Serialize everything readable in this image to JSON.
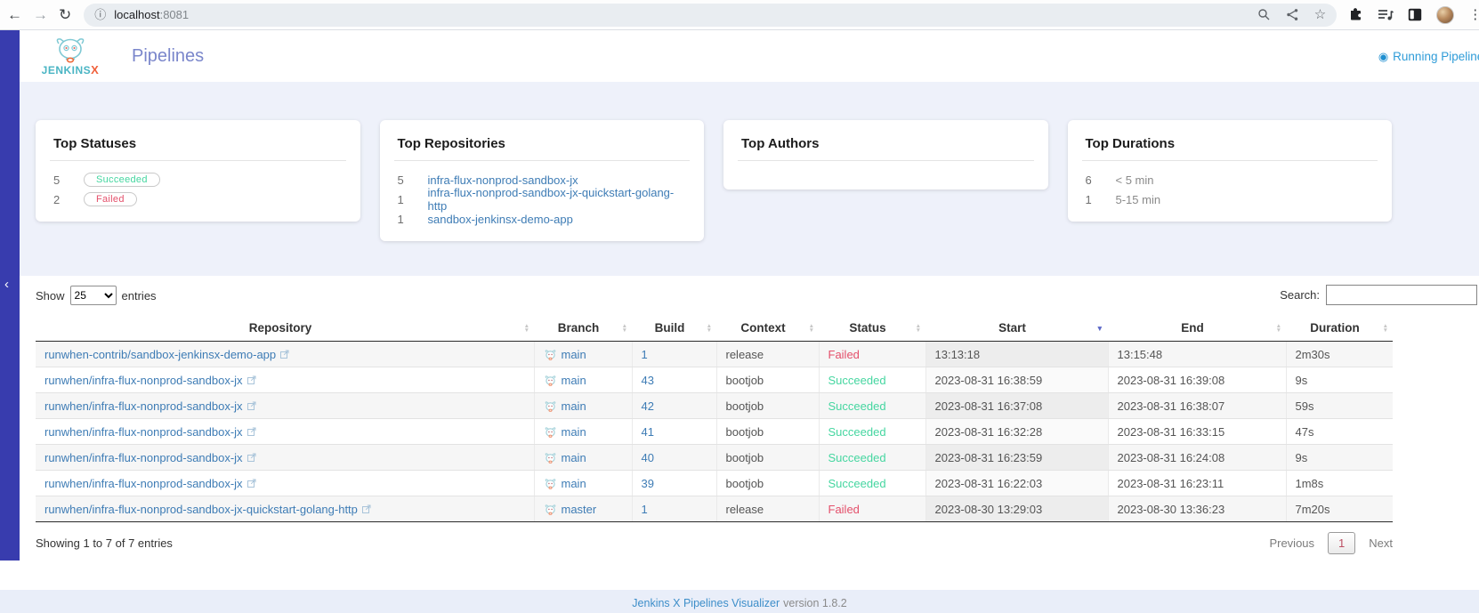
{
  "browser": {
    "url_host": "localhost",
    "url_port": ":8081"
  },
  "icons": {
    "back": "←",
    "forward": "→",
    "reload": "↻",
    "info": "ⓘ",
    "star": "☆",
    "menu": "⋮",
    "collapse": "‹",
    "radio": "◉"
  },
  "header": {
    "brand_jenkins": "JENKINS",
    "brand_x": "X",
    "title": "Pipelines",
    "running_label": "Running Pipelines"
  },
  "stats": {
    "statuses": {
      "title": "Top Statuses",
      "items": [
        {
          "count": "5",
          "label": "Succeeded",
          "type": "succeeded"
        },
        {
          "count": "2",
          "label": "Failed",
          "type": "failed"
        }
      ]
    },
    "repositories": {
      "title": "Top Repositories",
      "items": [
        {
          "count": "5",
          "label": "infra-flux-nonprod-sandbox-jx"
        },
        {
          "count": "1",
          "label": "infra-flux-nonprod-sandbox-jx-quickstart-golang-http"
        },
        {
          "count": "1",
          "label": "sandbox-jenkinsx-demo-app"
        }
      ]
    },
    "authors": {
      "title": "Top Authors",
      "items": []
    },
    "durations": {
      "title": "Top Durations",
      "items": [
        {
          "count": "6",
          "label": "< 5 min"
        },
        {
          "count": "1",
          "label": "5-15 min"
        }
      ]
    }
  },
  "table": {
    "show_label": "Show",
    "page_size": "25",
    "entries_label": "entries",
    "search_label": "Search:",
    "search_value": "",
    "columns": [
      {
        "label": "Repository",
        "sort": "none"
      },
      {
        "label": "Branch",
        "sort": "none"
      },
      {
        "label": "Build",
        "sort": "none"
      },
      {
        "label": "Context",
        "sort": "none"
      },
      {
        "label": "Status",
        "sort": "none"
      },
      {
        "label": "Start",
        "sort": "desc"
      },
      {
        "label": "End",
        "sort": "none"
      },
      {
        "label": "Duration",
        "sort": "none"
      }
    ],
    "rows": [
      {
        "repo": "runwhen-contrib/sandbox-jenkinsx-demo-app",
        "branch": "main",
        "build": "1",
        "context": "release",
        "status": "Failed",
        "start": "13:13:18",
        "end": "13:15:48",
        "duration": "2m30s"
      },
      {
        "repo": "runwhen/infra-flux-nonprod-sandbox-jx",
        "branch": "main",
        "build": "43",
        "context": "bootjob",
        "status": "Succeeded",
        "start": "2023-08-31 16:38:59",
        "end": "2023-08-31 16:39:08",
        "duration": "9s"
      },
      {
        "repo": "runwhen/infra-flux-nonprod-sandbox-jx",
        "branch": "main",
        "build": "42",
        "context": "bootjob",
        "status": "Succeeded",
        "start": "2023-08-31 16:37:08",
        "end": "2023-08-31 16:38:07",
        "duration": "59s"
      },
      {
        "repo": "runwhen/infra-flux-nonprod-sandbox-jx",
        "branch": "main",
        "build": "41",
        "context": "bootjob",
        "status": "Succeeded",
        "start": "2023-08-31 16:32:28",
        "end": "2023-08-31 16:33:15",
        "duration": "47s"
      },
      {
        "repo": "runwhen/infra-flux-nonprod-sandbox-jx",
        "branch": "main",
        "build": "40",
        "context": "bootjob",
        "status": "Succeeded",
        "start": "2023-08-31 16:23:59",
        "end": "2023-08-31 16:24:08",
        "duration": "9s"
      },
      {
        "repo": "runwhen/infra-flux-nonprod-sandbox-jx",
        "branch": "main",
        "build": "39",
        "context": "bootjob",
        "status": "Succeeded",
        "start": "2023-08-31 16:22:03",
        "end": "2023-08-31 16:23:11",
        "duration": "1m8s"
      },
      {
        "repo": "runwhen/infra-flux-nonprod-sandbox-jx-quickstart-golang-http",
        "branch": "master",
        "build": "1",
        "context": "release",
        "status": "Failed",
        "start": "2023-08-30 13:29:03",
        "end": "2023-08-30 13:36:23",
        "duration": "7m20s"
      }
    ],
    "summary": "Showing 1 to 7 of 7 entries",
    "pagination": {
      "previous": "Previous",
      "page": "1",
      "next": "Next"
    }
  },
  "footer": {
    "link": "Jenkins X Pipelines Visualizer",
    "version": "version 1.8.2"
  },
  "colors": {
    "succeeded": "#45d6a0",
    "failed": "#e4506b",
    "link": "#3e7cb5",
    "rail": "#383cae",
    "running": "#2f9cd8",
    "sort_active": "#5b67c7",
    "footer_link": "#3d8ec9"
  }
}
